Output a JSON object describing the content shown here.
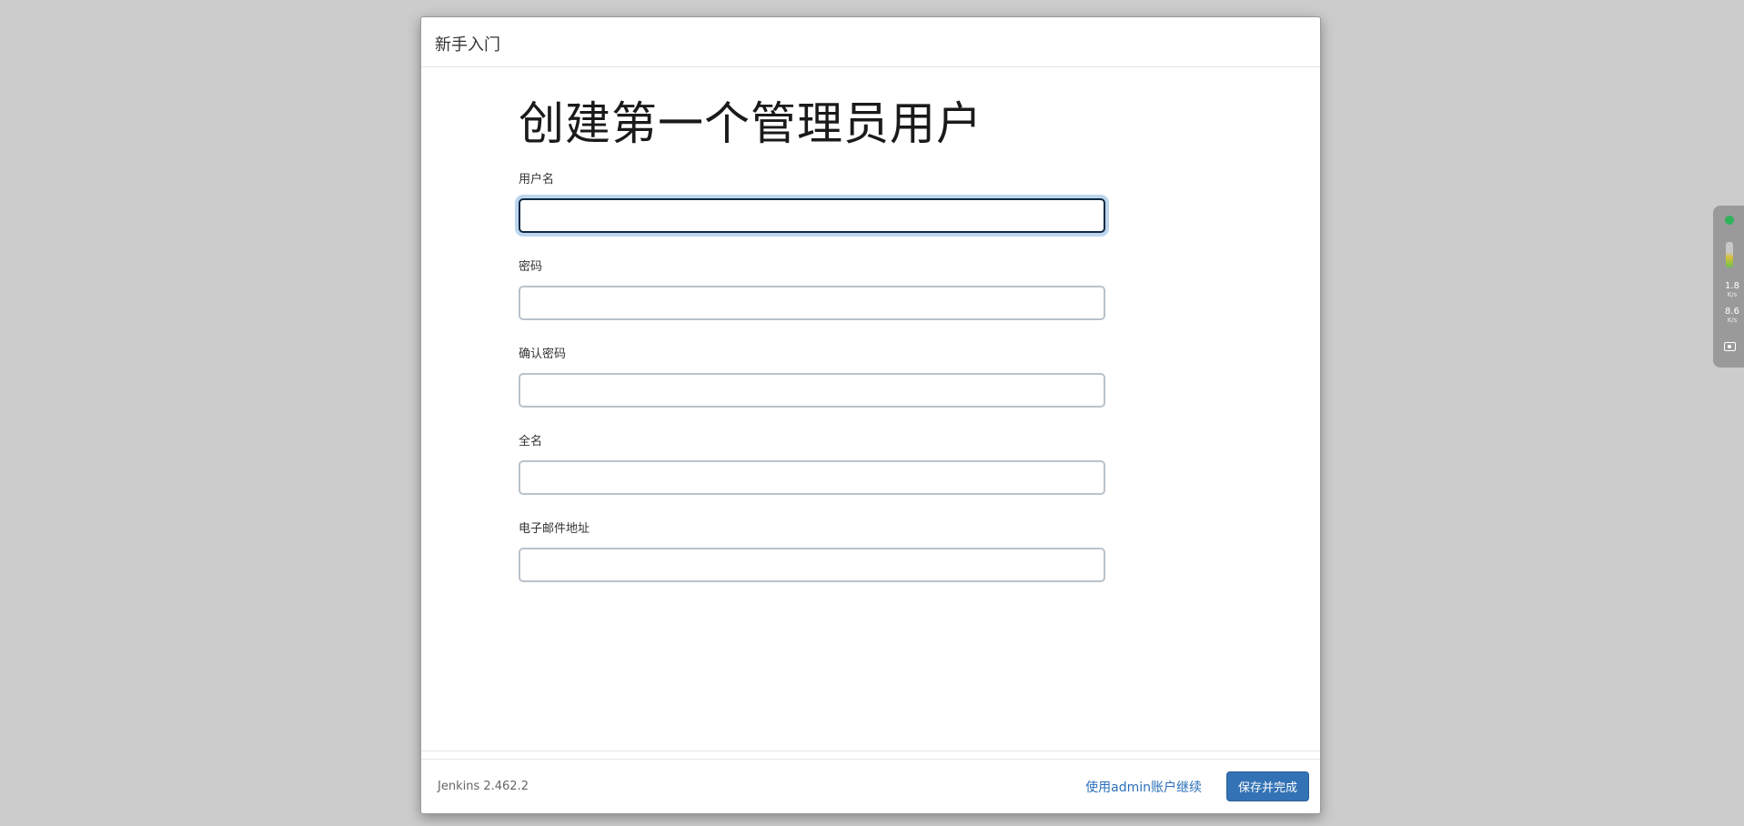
{
  "dialog": {
    "header_title": "新手入门",
    "page_title": "创建第一个管理员用户"
  },
  "form": {
    "fields": [
      {
        "label": "用户名",
        "value": ""
      },
      {
        "label": "密码",
        "value": ""
      },
      {
        "label": "确认密码",
        "value": ""
      },
      {
        "label": "全名",
        "value": ""
      },
      {
        "label": "电子邮件地址",
        "value": ""
      }
    ]
  },
  "footer": {
    "version": "Jenkins 2.462.2",
    "continue_link": "使用admin账户继续",
    "save_button": "保存并完成"
  },
  "side_widget": {
    "status_color": "#2fb35b",
    "upload_rate": "1.8",
    "upload_unit": "K/s",
    "download_rate": "8.6",
    "download_unit": "K/s",
    "camera_icon": "camera-icon"
  },
  "colors": {
    "accent": "#3372b5",
    "link": "#2a6fba",
    "background": "#cccccc"
  }
}
